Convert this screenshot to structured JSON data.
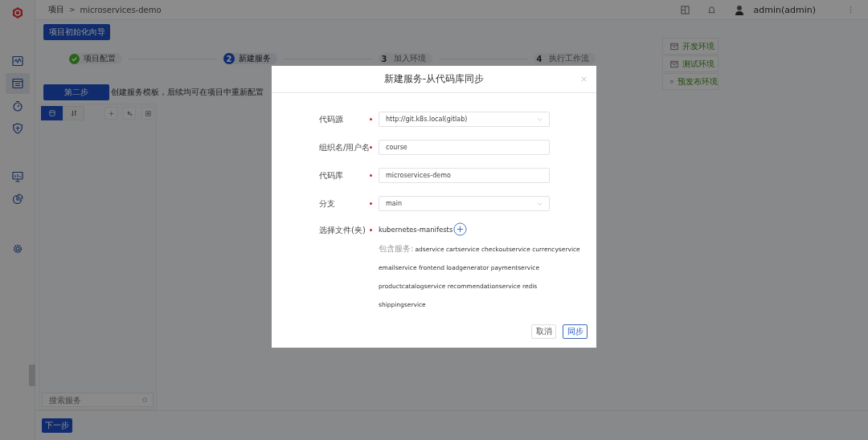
{
  "sidebar": {
    "items": [
      {
        "kind": "monitor-wave",
        "selected": false
      },
      {
        "kind": "window",
        "selected": true
      },
      {
        "kind": "timer",
        "selected": false
      },
      {
        "kind": "shield",
        "selected": false
      },
      {
        "kind": "screen",
        "selected": false
      },
      {
        "kind": "pie",
        "selected": false
      },
      {
        "kind": "gear",
        "selected": false
      }
    ]
  },
  "header": {
    "breadcrumb": [
      "项目",
      "microservices-demo"
    ],
    "separator": ">",
    "user": "admin(admin)"
  },
  "wizard_button": "项目初始化向导",
  "steps": [
    {
      "label": "项目配置",
      "done": true,
      "selected": false
    },
    {
      "number": "2",
      "label": "新建服务",
      "done": false,
      "selected": true
    },
    {
      "number": "3",
      "label": "加入环境",
      "done": false,
      "selected": false
    },
    {
      "number": "4",
      "label": "执行工作流",
      "done": false,
      "selected": false
    }
  ],
  "environments": [
    "开发环境",
    "测试环境",
    "预发布环境"
  ],
  "step_banner": {
    "button": "第二步",
    "text": "创建服务模板，后续均可在项目中重新配置"
  },
  "service_panel": {
    "view_tabs": [
      {
        "kind": "list",
        "selected": true
      },
      {
        "kind": "sort",
        "selected": false
      }
    ],
    "actions": [
      {
        "kind": "add"
      },
      {
        "kind": "branch"
      },
      {
        "kind": "image"
      }
    ],
    "search": {
      "placeholder": "搜索服务"
    }
  },
  "next_button": "下一步",
  "dialog": {
    "title": "新建服务-从代码库同步",
    "fields": [
      {
        "label": "代码源",
        "required": true,
        "kind": "select",
        "value": "http://git.k8s.local(gitlab)"
      },
      {
        "label": "组织名/用户名",
        "required": true,
        "kind": "input",
        "value": "course"
      },
      {
        "label": "代码库",
        "required": true,
        "kind": "input",
        "value": "microservices-demo"
      },
      {
        "label": "分支",
        "required": true,
        "kind": "select",
        "value": "main"
      },
      {
        "label": "选择文件(夹)",
        "required": true,
        "kind": "folder",
        "value": "kubernetes-manifests",
        "services_label": "包含服务:",
        "service_lines": [
          "adservice cartservice checkoutservice currencyservice",
          "emailservice frontend loadgenerator paymentservice",
          "productcatalogservice recommendationservice redis",
          "shippingservice"
        ]
      }
    ],
    "buttons": [
      {
        "label": "取消",
        "kind": "secondary"
      },
      {
        "label": "同步",
        "kind": "primary"
      }
    ]
  }
}
